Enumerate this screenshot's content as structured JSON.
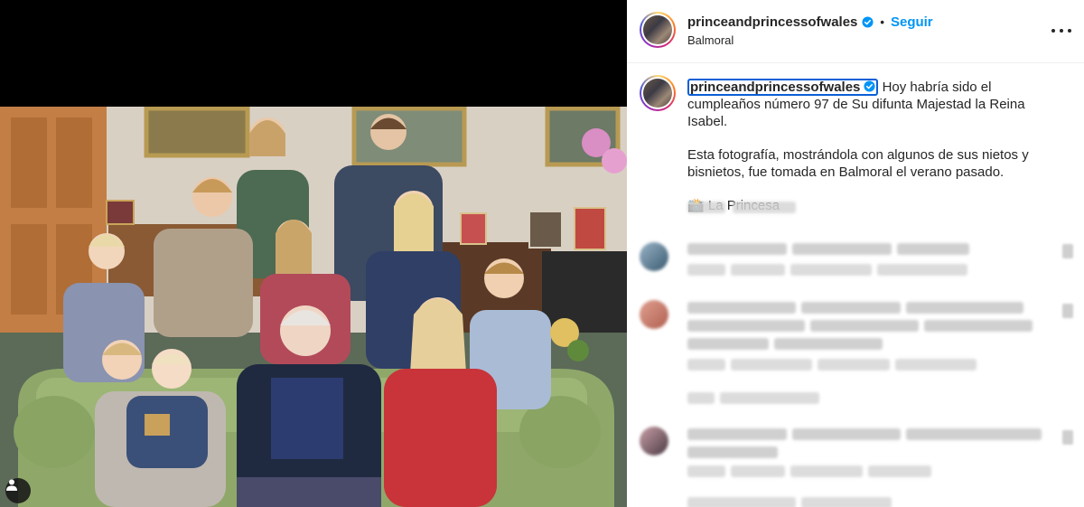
{
  "post": {
    "username": "princeandprincessofwales",
    "separator": "•",
    "follow_label": "Seguir",
    "location": "Balmoral"
  },
  "caption": {
    "username": "princeandprincessofwales",
    "line1": "Hoy habría sido el cumpleaños número 97 de Su difunta Majestad la Reina Isabel.",
    "line2": "Esta fotografía, mostrándola con algunos de sus nietos y bisnietos, fue tomada en Balmoral el verano pasado.",
    "signoff_icon": "📸",
    "signoff": "La Princesa"
  },
  "icons": {
    "verified": "verified-badge-icon",
    "more": "more-options-icon",
    "user_tag": "user-tag-icon"
  },
  "colors": {
    "accent": "#0095f6",
    "verified": "#0095f6",
    "text": "#262626",
    "focus_ring": "#0b5fd6"
  }
}
